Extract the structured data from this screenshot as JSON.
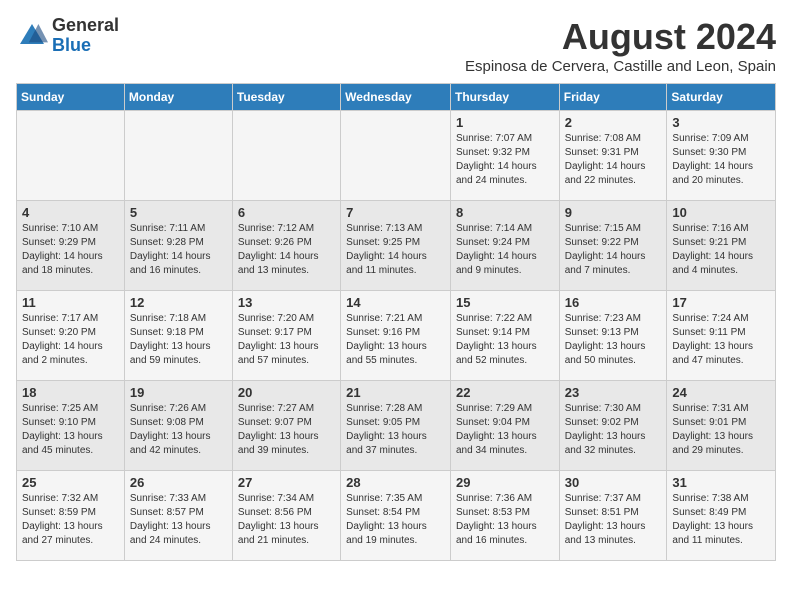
{
  "logo": {
    "general": "General",
    "blue": "Blue"
  },
  "header": {
    "month_year": "August 2024",
    "location": "Espinosa de Cervera, Castille and Leon, Spain"
  },
  "days_of_week": [
    "Sunday",
    "Monday",
    "Tuesday",
    "Wednesday",
    "Thursday",
    "Friday",
    "Saturday"
  ],
  "weeks": [
    [
      {
        "day": "",
        "info": ""
      },
      {
        "day": "",
        "info": ""
      },
      {
        "day": "",
        "info": ""
      },
      {
        "day": "",
        "info": ""
      },
      {
        "day": "1",
        "info": "Sunrise: 7:07 AM\nSunset: 9:32 PM\nDaylight: 14 hours and 24 minutes."
      },
      {
        "day": "2",
        "info": "Sunrise: 7:08 AM\nSunset: 9:31 PM\nDaylight: 14 hours and 22 minutes."
      },
      {
        "day": "3",
        "info": "Sunrise: 7:09 AM\nSunset: 9:30 PM\nDaylight: 14 hours and 20 minutes."
      }
    ],
    [
      {
        "day": "4",
        "info": "Sunrise: 7:10 AM\nSunset: 9:29 PM\nDaylight: 14 hours and 18 minutes."
      },
      {
        "day": "5",
        "info": "Sunrise: 7:11 AM\nSunset: 9:28 PM\nDaylight: 14 hours and 16 minutes."
      },
      {
        "day": "6",
        "info": "Sunrise: 7:12 AM\nSunset: 9:26 PM\nDaylight: 14 hours and 13 minutes."
      },
      {
        "day": "7",
        "info": "Sunrise: 7:13 AM\nSunset: 9:25 PM\nDaylight: 14 hours and 11 minutes."
      },
      {
        "day": "8",
        "info": "Sunrise: 7:14 AM\nSunset: 9:24 PM\nDaylight: 14 hours and 9 minutes."
      },
      {
        "day": "9",
        "info": "Sunrise: 7:15 AM\nSunset: 9:22 PM\nDaylight: 14 hours and 7 minutes."
      },
      {
        "day": "10",
        "info": "Sunrise: 7:16 AM\nSunset: 9:21 PM\nDaylight: 14 hours and 4 minutes."
      }
    ],
    [
      {
        "day": "11",
        "info": "Sunrise: 7:17 AM\nSunset: 9:20 PM\nDaylight: 14 hours and 2 minutes."
      },
      {
        "day": "12",
        "info": "Sunrise: 7:18 AM\nSunset: 9:18 PM\nDaylight: 13 hours and 59 minutes."
      },
      {
        "day": "13",
        "info": "Sunrise: 7:20 AM\nSunset: 9:17 PM\nDaylight: 13 hours and 57 minutes."
      },
      {
        "day": "14",
        "info": "Sunrise: 7:21 AM\nSunset: 9:16 PM\nDaylight: 13 hours and 55 minutes."
      },
      {
        "day": "15",
        "info": "Sunrise: 7:22 AM\nSunset: 9:14 PM\nDaylight: 13 hours and 52 minutes."
      },
      {
        "day": "16",
        "info": "Sunrise: 7:23 AM\nSunset: 9:13 PM\nDaylight: 13 hours and 50 minutes."
      },
      {
        "day": "17",
        "info": "Sunrise: 7:24 AM\nSunset: 9:11 PM\nDaylight: 13 hours and 47 minutes."
      }
    ],
    [
      {
        "day": "18",
        "info": "Sunrise: 7:25 AM\nSunset: 9:10 PM\nDaylight: 13 hours and 45 minutes."
      },
      {
        "day": "19",
        "info": "Sunrise: 7:26 AM\nSunset: 9:08 PM\nDaylight: 13 hours and 42 minutes."
      },
      {
        "day": "20",
        "info": "Sunrise: 7:27 AM\nSunset: 9:07 PM\nDaylight: 13 hours and 39 minutes."
      },
      {
        "day": "21",
        "info": "Sunrise: 7:28 AM\nSunset: 9:05 PM\nDaylight: 13 hours and 37 minutes."
      },
      {
        "day": "22",
        "info": "Sunrise: 7:29 AM\nSunset: 9:04 PM\nDaylight: 13 hours and 34 minutes."
      },
      {
        "day": "23",
        "info": "Sunrise: 7:30 AM\nSunset: 9:02 PM\nDaylight: 13 hours and 32 minutes."
      },
      {
        "day": "24",
        "info": "Sunrise: 7:31 AM\nSunset: 9:01 PM\nDaylight: 13 hours and 29 minutes."
      }
    ],
    [
      {
        "day": "25",
        "info": "Sunrise: 7:32 AM\nSunset: 8:59 PM\nDaylight: 13 hours and 27 minutes."
      },
      {
        "day": "26",
        "info": "Sunrise: 7:33 AM\nSunset: 8:57 PM\nDaylight: 13 hours and 24 minutes."
      },
      {
        "day": "27",
        "info": "Sunrise: 7:34 AM\nSunset: 8:56 PM\nDaylight: 13 hours and 21 minutes."
      },
      {
        "day": "28",
        "info": "Sunrise: 7:35 AM\nSunset: 8:54 PM\nDaylight: 13 hours and 19 minutes."
      },
      {
        "day": "29",
        "info": "Sunrise: 7:36 AM\nSunset: 8:53 PM\nDaylight: 13 hours and 16 minutes."
      },
      {
        "day": "30",
        "info": "Sunrise: 7:37 AM\nSunset: 8:51 PM\nDaylight: 13 hours and 13 minutes."
      },
      {
        "day": "31",
        "info": "Sunrise: 7:38 AM\nSunset: 8:49 PM\nDaylight: 13 hours and 11 minutes."
      }
    ]
  ]
}
